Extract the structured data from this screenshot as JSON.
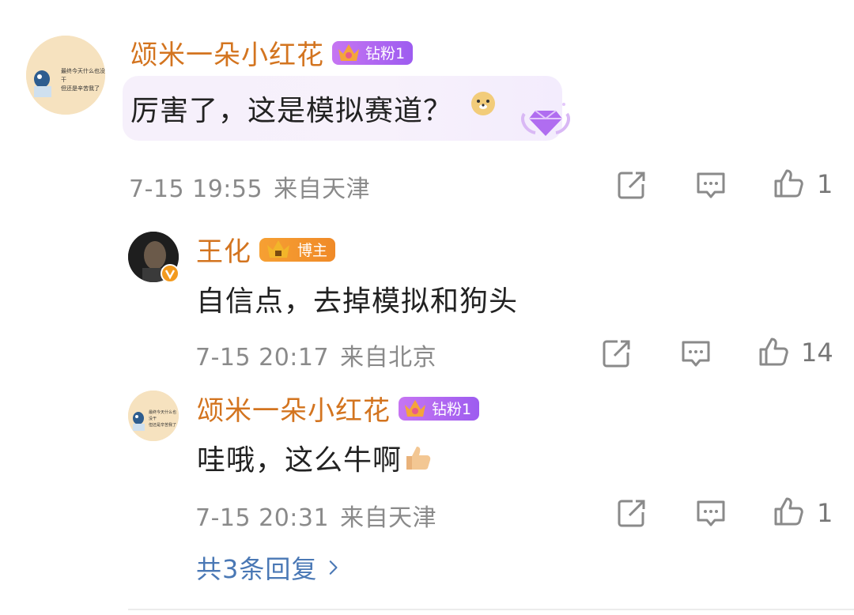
{
  "comments": [
    {
      "username": "颂米一朵小红花",
      "badge": "钻粉1",
      "crown_level": "6",
      "text": "厉害了，这是模拟赛道？",
      "time": "7-15 19:55",
      "location": "来自天津",
      "likes": "1",
      "avatar_text": [
        "最终今天什么也没干",
        "但还是辛苦我了"
      ]
    },
    {
      "username": "王化",
      "badge": "博主",
      "crown_level": "II",
      "text": "自信点，去掉模拟和狗头",
      "time": "7-15 20:17",
      "location": "来自北京",
      "likes": "14"
    },
    {
      "username": "颂米一朵小红花",
      "badge": "钻粉1",
      "crown_level": "6",
      "text": "哇哦，这么牛啊",
      "time": "7-15 20:31",
      "location": "来自天津",
      "likes": "1",
      "avatar_text": [
        "最终今天什么也没干",
        "但还是辛苦我了"
      ]
    }
  ],
  "replies_link": "共3条回复",
  "colors": {
    "username": "#d3741f",
    "link": "#4a78b5",
    "meta": "#8a8a8a",
    "fan_badge": "#b067f1",
    "blogger_badge": "#f39330"
  },
  "icons": [
    "share-icon",
    "comment-icon",
    "like-icon",
    "chevron-right-icon",
    "doge-emoji",
    "thumbs-up-emoji",
    "diamond-decoration",
    "verified-icon"
  ]
}
